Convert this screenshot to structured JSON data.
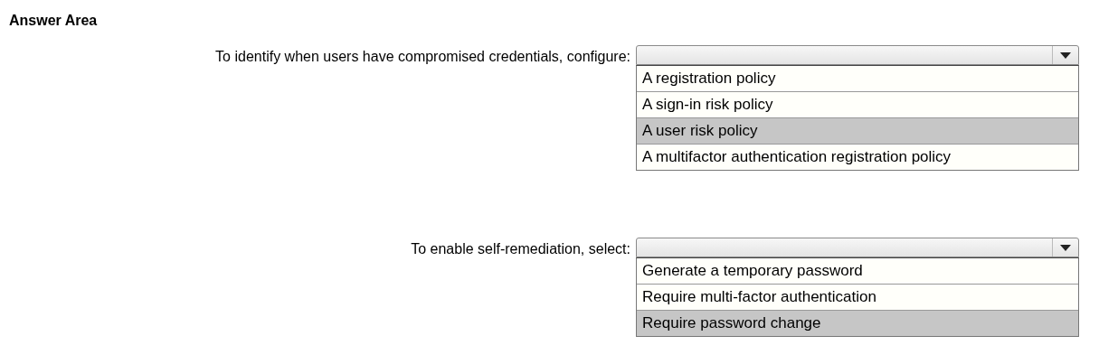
{
  "title": "Answer Area",
  "questions": [
    {
      "prompt": "To identify when users have compromised credentials, configure:",
      "options": [
        {
          "label": "A registration policy",
          "selected": false
        },
        {
          "label": "A sign-in risk policy",
          "selected": false
        },
        {
          "label": "A user risk policy",
          "selected": true
        },
        {
          "label": "A multifactor authentication registration policy",
          "selected": false
        }
      ]
    },
    {
      "prompt": "To enable self-remediation, select:",
      "options": [
        {
          "label": "Generate a temporary password",
          "selected": false
        },
        {
          "label": "Require multi-factor authentication",
          "selected": false
        },
        {
          "label": "Require password change",
          "selected": true
        }
      ]
    }
  ]
}
